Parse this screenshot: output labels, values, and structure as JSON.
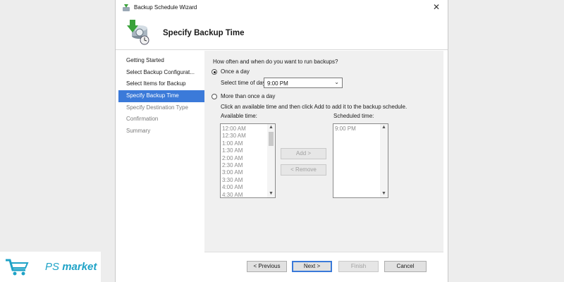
{
  "window": {
    "title": "Backup Schedule Wizard",
    "close_glyph": "✕",
    "header_title": "Specify Backup Time",
    "icons": [
      "backup-wizard-icon",
      "backup-drive-icon",
      "close-icon"
    ]
  },
  "nav": {
    "items": [
      {
        "label": "Getting Started",
        "state": "done"
      },
      {
        "label": "Select Backup Configurat...",
        "state": "done"
      },
      {
        "label": "Select Items for Backup",
        "state": "done"
      },
      {
        "label": "Specify Backup Time",
        "state": "active"
      },
      {
        "label": "Specify Destination Type",
        "state": "future"
      },
      {
        "label": "Confirmation",
        "state": "future"
      },
      {
        "label": "Summary",
        "state": "future"
      }
    ]
  },
  "content": {
    "question": "How often and when do you want to run backups?",
    "once_a_day_label": "Once a day",
    "once_a_day_selected": true,
    "select_time_label": "Select time of day:",
    "selected_time": "9:00 PM",
    "more_than_once_label": "More than once a day",
    "more_than_once_selected": false,
    "instruction": "Click an available time and then click Add to add it to the backup schedule.",
    "available_label": "Available time:",
    "available_times": [
      "12:00 AM",
      "12:30 AM",
      "1:00 AM",
      "1:30 AM",
      "2:00 AM",
      "2:30 AM",
      "3:00 AM",
      "3:30 AM",
      "4:00 AM",
      "4:30 AM"
    ],
    "scheduled_label": "Scheduled time:",
    "scheduled_times": [
      "9:00 PM"
    ],
    "add_button": "Add >",
    "remove_button": "< Remove"
  },
  "footer": {
    "previous": "< Previous",
    "next": "Next >",
    "finish": "Finish",
    "cancel": "Cancel"
  },
  "watermark": {
    "logo_text": "PS",
    "market_text": "market",
    "color": "#1fa3c7"
  },
  "colors": {
    "accent": "#3b7ad9",
    "content_bg": "#f0f0f0",
    "disabled_text": "#a0a0a0"
  }
}
